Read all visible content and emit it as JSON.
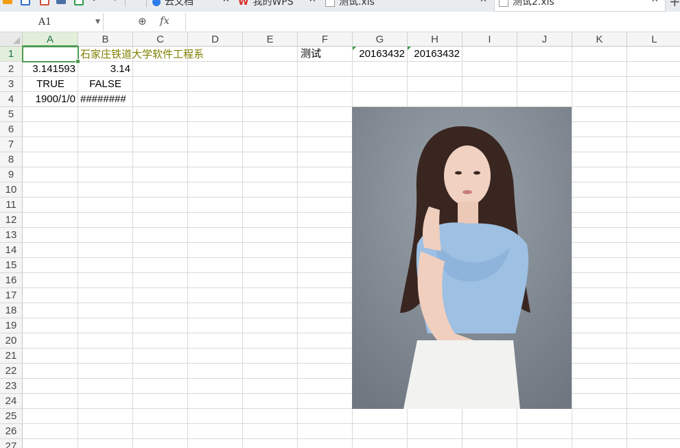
{
  "tabs": [
    {
      "label": "云文档",
      "icon": "cloud-doc-icon"
    },
    {
      "label": "我的WPS",
      "icon": "wps-logo-icon"
    },
    {
      "label": "测试.xls",
      "icon": "xls-file-icon"
    },
    {
      "label": "测试2.xls",
      "icon": "xls-file-icon",
      "active": true
    }
  ],
  "formula_bar": {
    "name_box": "A1",
    "fx_label": "fx",
    "formula": ""
  },
  "columns": [
    "A",
    "B",
    "C",
    "D",
    "E",
    "F",
    "G",
    "H",
    "I",
    "J",
    "K",
    "L"
  ],
  "rows": [
    "1",
    "2",
    "3",
    "4",
    "5",
    "6",
    "7",
    "8",
    "9",
    "10",
    "11",
    "12",
    "13",
    "14",
    "15",
    "16",
    "17",
    "18",
    "19",
    "20",
    "21",
    "22",
    "23",
    "24",
    "25",
    "26",
    "27"
  ],
  "cells": {
    "A1": "",
    "B1": "石家庄铁道大学软件工程系",
    "F1": "测试",
    "G1": "20163432",
    "H1": "20163432",
    "A2": "3.141593",
    "B2": "3.14",
    "A3": "TRUE",
    "B3": "FALSE",
    "A4": "1900/1/0",
    "B4": "########"
  },
  "selected_cell": "A1",
  "colors": {
    "accent": "#4c9a52",
    "olive_text": "#7f7f00"
  },
  "picture": {
    "description_icon": "embedded-photo"
  }
}
